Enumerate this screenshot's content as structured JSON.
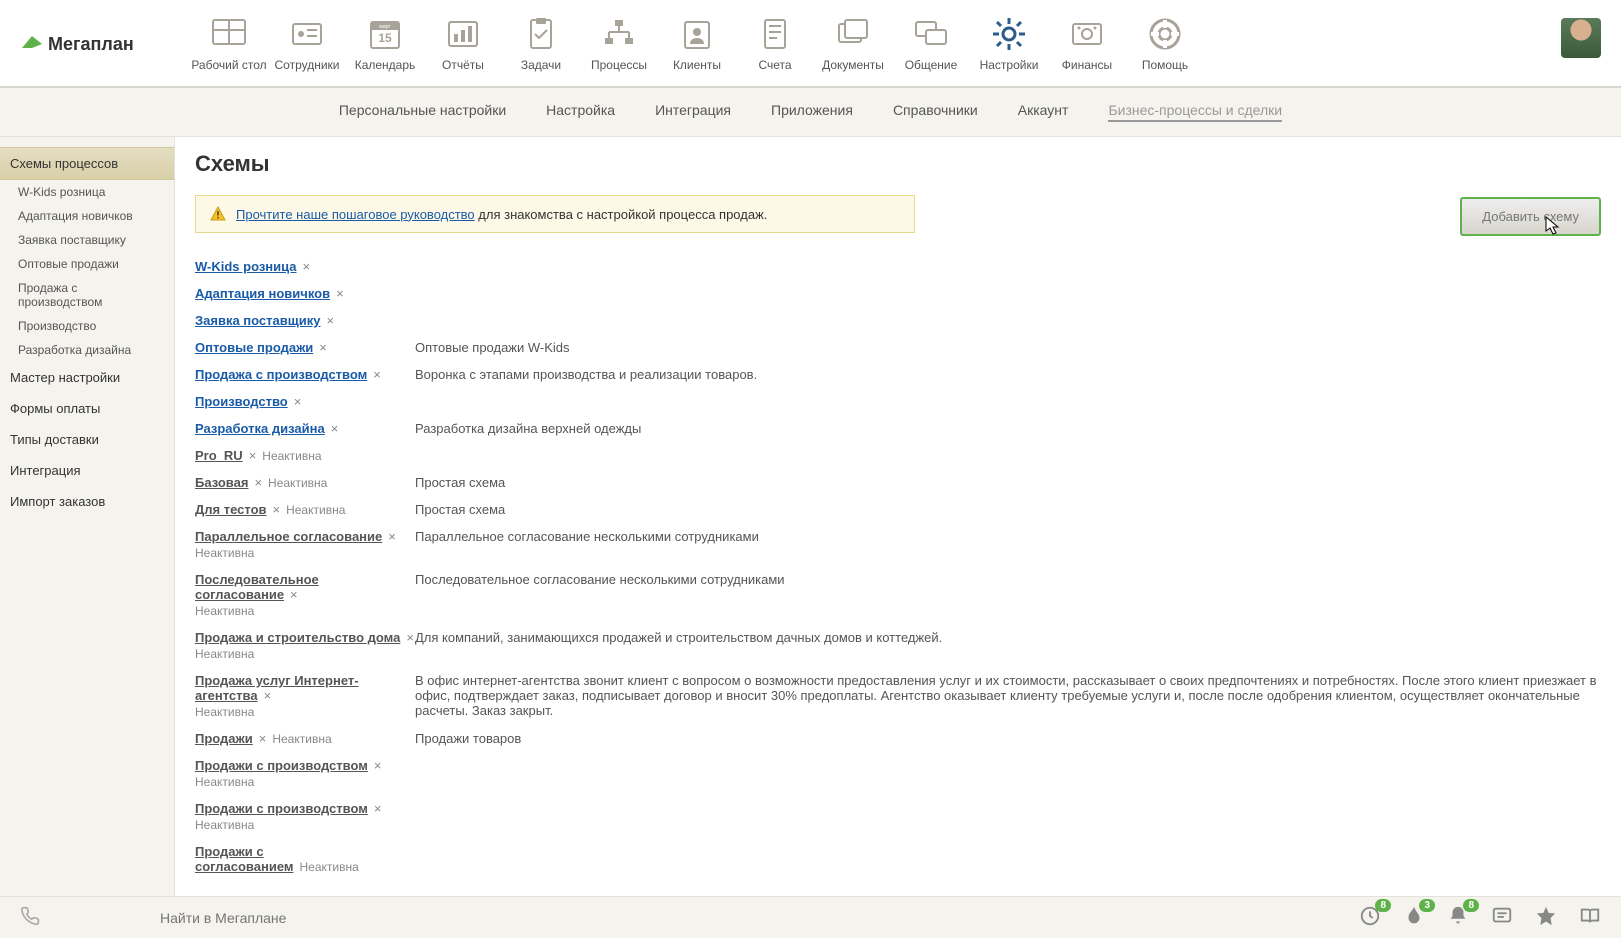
{
  "app": {
    "name": "Мегаплан"
  },
  "topnav": [
    {
      "id": "desktop",
      "label": "Рабочий стол"
    },
    {
      "id": "employees",
      "label": "Сотрудники"
    },
    {
      "id": "calendar",
      "label": "Календарь",
      "day": "15",
      "month": "март"
    },
    {
      "id": "reports",
      "label": "Отчёты"
    },
    {
      "id": "tasks",
      "label": "Задачи"
    },
    {
      "id": "processes",
      "label": "Процессы"
    },
    {
      "id": "clients",
      "label": "Клиенты"
    },
    {
      "id": "invoices",
      "label": "Счета"
    },
    {
      "id": "documents",
      "label": "Документы"
    },
    {
      "id": "communication",
      "label": "Общение"
    },
    {
      "id": "settings",
      "label": "Настройки",
      "active": true
    },
    {
      "id": "finance",
      "label": "Финансы"
    },
    {
      "id": "help",
      "label": "Помощь"
    }
  ],
  "subnav": [
    {
      "id": "personal",
      "label": "Персональные настройки"
    },
    {
      "id": "setup",
      "label": "Настройка"
    },
    {
      "id": "integration",
      "label": "Интеграция"
    },
    {
      "id": "apps",
      "label": "Приложения"
    },
    {
      "id": "directories",
      "label": "Справочники"
    },
    {
      "id": "account",
      "label": "Аккаунт"
    },
    {
      "id": "bp",
      "label": "Бизнес-процессы и сделки",
      "active": true
    }
  ],
  "sidebar": {
    "sections": [
      {
        "label": "Схемы процессов",
        "active": true,
        "children": [
          {
            "label": "W-Kids розница"
          },
          {
            "label": "Адаптация новичков"
          },
          {
            "label": "Заявка поставщику"
          },
          {
            "label": "Оптовые продажи"
          },
          {
            "label": "Продажа с производством"
          },
          {
            "label": "Производство"
          },
          {
            "label": "Разработка дизайна"
          }
        ]
      },
      {
        "label": "Мастер настройки"
      },
      {
        "label": "Формы оплаты"
      },
      {
        "label": "Типы доставки"
      },
      {
        "label": "Интеграция"
      },
      {
        "label": "Импорт заказов"
      }
    ]
  },
  "page": {
    "title": "Схемы",
    "notice_link": "Прочтите наше пошаговое руководство",
    "notice_rest": " для знакомства с настройкой процесса продаж.",
    "add_button": "Добавить схему",
    "inactive_label": "Неактивна"
  },
  "schemes": [
    {
      "name": "W-Kids розница",
      "active": true,
      "desc": ""
    },
    {
      "name": "Адаптация новичков",
      "active": true,
      "desc": ""
    },
    {
      "name": "Заявка поставщику",
      "active": true,
      "desc": ""
    },
    {
      "name": "Оптовые продажи",
      "active": true,
      "desc": "Оптовые продажи W-Kids"
    },
    {
      "name": "Продажа с производством",
      "active": true,
      "desc": "Воронка с этапами производства и реализации товаров."
    },
    {
      "name": "Производство",
      "active": true,
      "desc": ""
    },
    {
      "name": "Разработка дизайна",
      "active": true,
      "desc": "Разработка дизайна верхней одежды"
    },
    {
      "name": "Pro_RU",
      "active": false,
      "desc": ""
    },
    {
      "name": "Базовая",
      "active": false,
      "desc": "Простая схема"
    },
    {
      "name": "Для тестов",
      "active": false,
      "desc": "Простая схема"
    },
    {
      "name": "Параллельное согласование",
      "active": false,
      "desc": "Параллельное согласование несколькими сотрудниками",
      "wrap": true
    },
    {
      "name": "Последовательное согласование",
      "active": false,
      "desc": "Последовательное согласование несколькими сотрудниками",
      "wrap": true
    },
    {
      "name": "Продажа и строительство дома",
      "active": false,
      "desc": "Для компаний, занимающихся продажей и строительством дачных домов и коттеджей.",
      "wrap": true
    },
    {
      "name": "Продажа услуг Интернет-агентства",
      "active": false,
      "desc": "В офис интернет-агентства звонит клиент с вопросом о возможности предоставления услуг и их стоимости, рассказывает о своих предпочтениях и потребностях. После этого клиент приезжает в офис, подтверждает заказ, подписывает договор и вносит 30% предоплаты. Агентство оказывает клиенту требуемые услуги и, после после одобрения клиентом, осуществляет окончательные расчеты. Заказ закрыт.",
      "wrap": true
    },
    {
      "name": "Продажи",
      "active": false,
      "desc": "Продажи товаров"
    },
    {
      "name": "Продажи с производством",
      "active": false,
      "desc": "",
      "wrap": true
    },
    {
      "name": "Продажи с производством",
      "active": false,
      "desc": "",
      "wrap": true
    },
    {
      "name": "Продажи с согласованием",
      "active": false,
      "desc": "",
      "last": true
    }
  ],
  "footer": {
    "search_placeholder": "Найти в Мегаплане",
    "badges": {
      "clock": "8",
      "fire": "3",
      "bell": "8"
    }
  }
}
